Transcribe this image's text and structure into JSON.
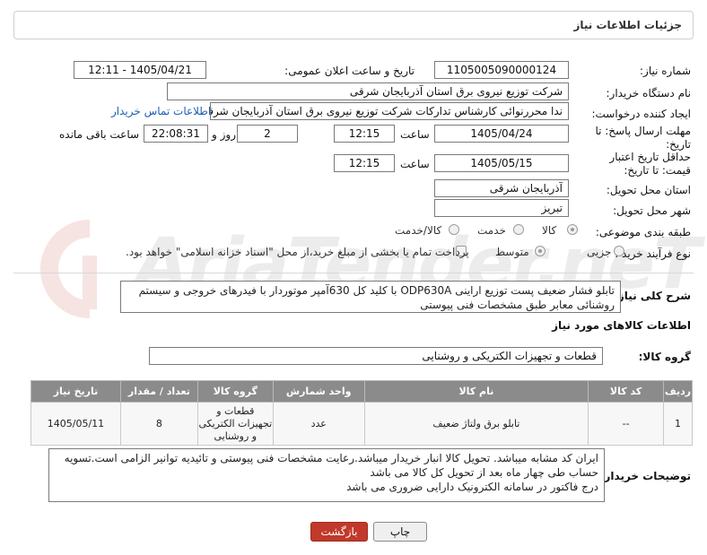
{
  "header": {
    "title": "جزئیات اطلاعات نیاز"
  },
  "fields": {
    "need_number_label": "شماره نیاز:",
    "need_number": "1105005090000124",
    "announce_label": "تاریخ و ساعت اعلان عمومی:",
    "announce_value": "1405/04/21 - 12:11",
    "buyer_org_label": "نام دستگاه خریدار:",
    "buyer_org": "شرکت توزیع نیروی برق استان آذربایجان شرقی",
    "creator_label": "ایجاد کننده درخواست:",
    "creator": "ندا محررنوائی کارشناس تدارکات شرکت توزیع نیروی برق استان آذربایجان شرقی",
    "contact_link": "اطلاعات تماس خریدار",
    "reply_deadline_label": "مهلت ارسال پاسخ: تا تاریخ:",
    "reply_date": "1405/04/24",
    "time_label": "ساعت",
    "reply_time": "12:15",
    "days_value": "2",
    "days_label": "روز و",
    "remaining_time": "22:08:31",
    "remaining_label": "ساعت باقی مانده",
    "validity_label": "حداقل تاریخ اعتبار قیمت: تا تاریخ:",
    "validity_date": "1405/05/15",
    "validity_time": "12:15",
    "province_label": "استان محل تحویل:",
    "province": "آذربایجان شرقی",
    "city_label": "شهر محل تحویل:",
    "city": "تبریز",
    "category_label": "طبقه بندی موضوعی:",
    "category_options": [
      "کالا",
      "خدمت",
      "کالا/خدمت"
    ],
    "process_label": "نوع فرآیند خرید :",
    "process_options": [
      "جزیی",
      "متوسط"
    ],
    "payment_note": "پرداخت تمام یا بخشی از مبلغ خرید،از محل \"اسناد خزانه اسلامی\" خواهد بود."
  },
  "description": {
    "label": "شرح کلی نیاز:",
    "text": "تابلو فشار ضعیف پست توزیع اراینی ODP630A با کلید کل 630آمپر موتوردار با فیدرهای خروجی و سیستم روشنائی معابر طبق مشخصات فنی پیوستی"
  },
  "goods_info_title": "اطلاعات کالاهای مورد نیاز",
  "goods_group": {
    "label": "گروه کالا:",
    "value": "قطعات و تجهیزات الکتریکی و روشنایی"
  },
  "table": {
    "headers": [
      "ردیف",
      "کد کالا",
      "نام کالا",
      "واحد شمارش",
      "گروه کالا",
      "تعداد / مقدار",
      "تاریخ نیاز"
    ],
    "rows": [
      [
        "1",
        "--",
        "تابلو برق ولتاژ ضعیف",
        "عدد",
        "قطعات و تجهیزات الکتریکی و روشنایی",
        "8",
        "1405/05/11"
      ]
    ]
  },
  "buyer_notes": {
    "label": "توضیحات خریدار:",
    "lines": [
      "ایران کد مشابه میباشد. تحویل کالا انبار خریدار میباشد.رعایت مشخصات فنی پیوستی و تائیدیه توانیر الزامی است.تسویه",
      "حساب طی چهار ماه بعد از تحویل کل کالا می باشد",
      "درج فاکتور در سامانه الکترونیک دارایی ضروری می باشد"
    ]
  },
  "buttons": {
    "print": "چاپ",
    "back": "بازگشت"
  },
  "colors": {
    "table_header": "#8b8b8b",
    "back_button": "#c0392b",
    "link": "#1a5fb4"
  }
}
